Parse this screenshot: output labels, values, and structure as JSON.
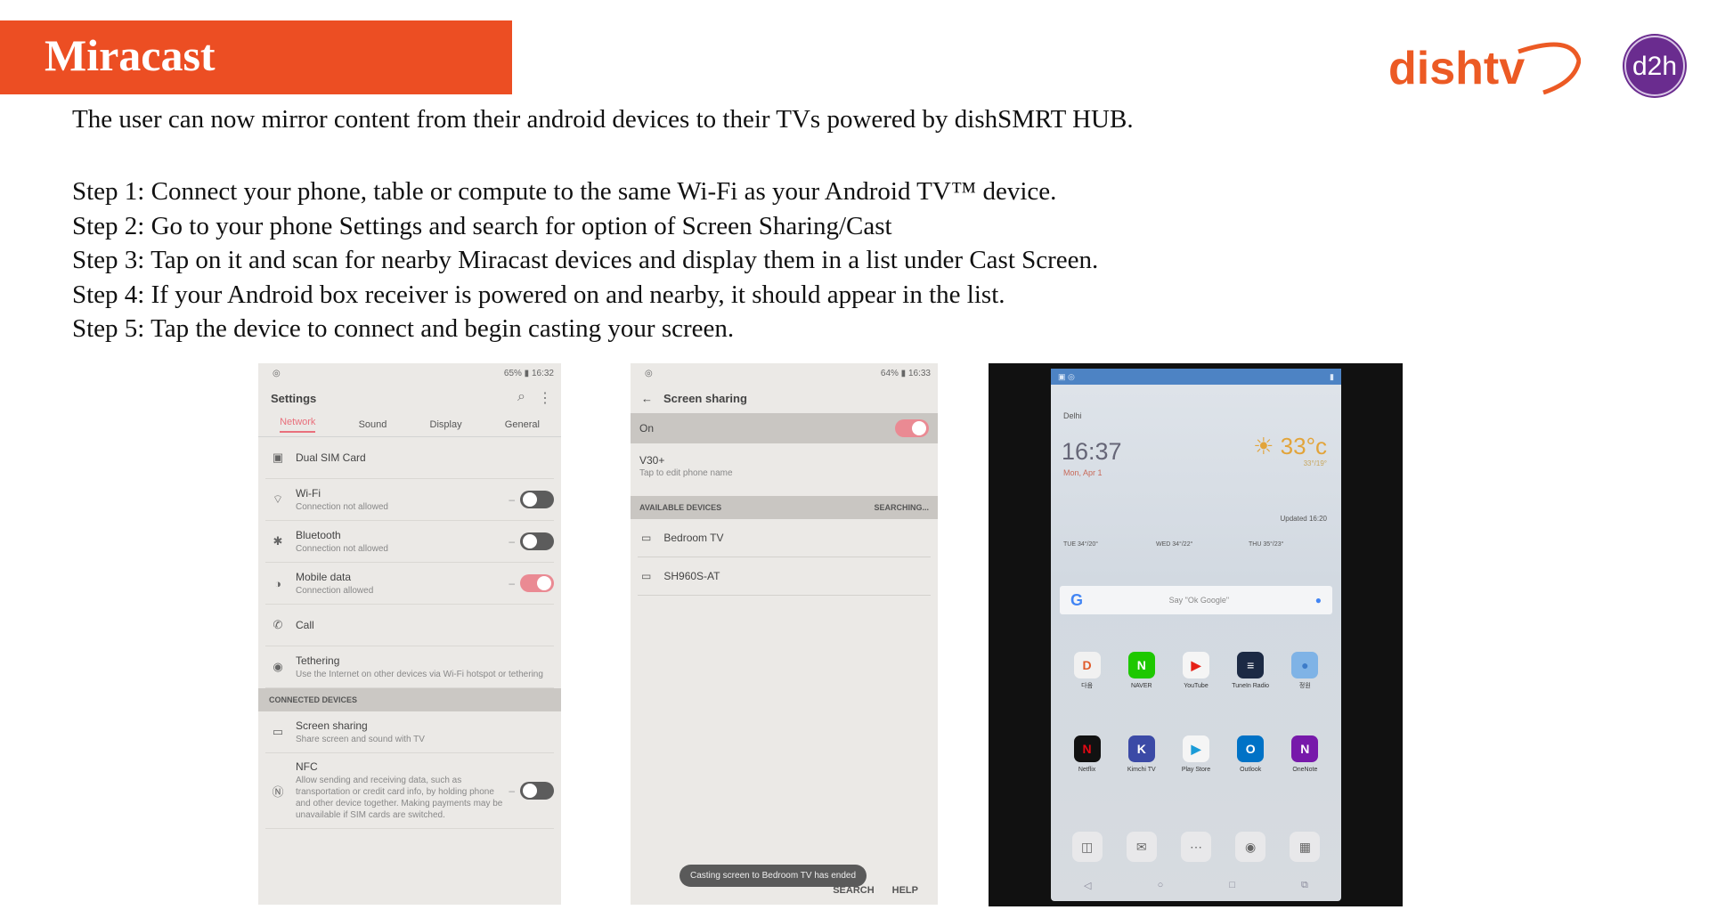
{
  "header": {
    "title": "Miracast",
    "brand_logo_dishtv": "dishtv",
    "brand_logo_d2h": "d2h"
  },
  "intro": "The user can now mirror content from their android devices to their TVs powered by dishSMRT HUB.",
  "steps": [
    "Step 1: Connect your phone, table or compute to the same Wi-Fi as your Android TV™ device.",
    "Step 2: Go to your phone Settings and search for option of Screen Sharing/Cast",
    "Step 3: Tap on it and scan for nearby Miracast devices and display them in a list under Cast Screen.",
    "Step 4: If your Android box receiver is powered on and nearby, it should appear in the list.",
    "Step 5: Tap the device to connect and begin casting your screen."
  ],
  "screenshot1": {
    "status_time": "65% ▮ 16:32",
    "title": "Settings",
    "tabs": [
      "Network",
      "Sound",
      "Display",
      "General"
    ],
    "rows": [
      {
        "label": "Dual SIM Card",
        "sub": "",
        "toggle": "none",
        "icon": "sim-icon"
      },
      {
        "label": "Wi-Fi",
        "sub": "Connection not allowed",
        "toggle": "off",
        "icon": "wifi-icon"
      },
      {
        "label": "Bluetooth",
        "sub": "Connection not allowed",
        "toggle": "off",
        "icon": "bluetooth-icon"
      },
      {
        "label": "Mobile data",
        "sub": "Connection allowed",
        "toggle": "on",
        "icon": "mobile-data-icon"
      },
      {
        "label": "Call",
        "sub": "",
        "toggle": "none",
        "icon": "phone-icon"
      },
      {
        "label": "Tethering",
        "sub": "Use the Internet on other devices via Wi-Fi hotspot or tethering",
        "toggle": "none",
        "icon": "tethering-icon"
      }
    ],
    "section": "CONNECTED DEVICES",
    "rows2": [
      {
        "label": "Screen sharing",
        "sub": "Share screen and sound with TV",
        "icon": "cast-icon"
      },
      {
        "label": "NFC",
        "sub": "Allow sending and receiving data, such as transportation or credit card info, by holding phone and other device together. Making payments may be unavailable if SIM cards are switched.",
        "icon": "nfc-icon"
      }
    ]
  },
  "screenshot2": {
    "status_time": "64% ▮ 16:33",
    "title": "Screen sharing",
    "on_label": "On",
    "device_name": "V30+",
    "device_sub": "Tap to edit phone name",
    "available": "AVAILABLE DEVICES",
    "searching": "SEARCHING...",
    "devices": [
      "Bedroom TV",
      "SH960S-AT"
    ],
    "toast": "Casting screen to Bedroom TV has ended",
    "actions": [
      "SEARCH",
      "HELP"
    ]
  },
  "screenshot3": {
    "city": "Delhi",
    "time": "16:37",
    "date": "Mon, Apr 1",
    "temp": "33°c",
    "temp_range": "33°/19°",
    "updated": "Updated 16:20",
    "forecast": [
      "TUE 34°/20°",
      "WED 34°/22°",
      "THU 35°/23°"
    ],
    "search_hint": "Say \"Ok Google\"",
    "apps_row1": [
      {
        "label": "다음",
        "glyph": "D",
        "color": "#f1f1f1",
        "fg": "#e05a2a"
      },
      {
        "label": "NAVER",
        "glyph": "N",
        "color": "#1ec800",
        "fg": "#ffffff"
      },
      {
        "label": "YouTube",
        "glyph": "▶",
        "color": "#f5f5f5",
        "fg": "#e62117"
      },
      {
        "label": "TuneIn Radio",
        "glyph": "≡",
        "color": "#1c2a44",
        "fg": "#ffffff"
      },
      {
        "label": "정원",
        "glyph": "●",
        "color": "#7fb3e6",
        "fg": "#3d7cc9"
      }
    ],
    "apps_row2": [
      {
        "label": "Netflix",
        "glyph": "N",
        "color": "#111111",
        "fg": "#e50914"
      },
      {
        "label": "Kimchi TV",
        "glyph": "K",
        "color": "#3b4aa6",
        "fg": "#ffffff"
      },
      {
        "label": "Play Store",
        "glyph": "▶",
        "color": "#f5f5f5",
        "fg": "#1a9bd7"
      },
      {
        "label": "Outlook",
        "glyph": "O",
        "color": "#0072c6",
        "fg": "#ffffff"
      },
      {
        "label": "OneNote",
        "glyph": "N",
        "color": "#7719aa",
        "fg": "#ffffff"
      }
    ]
  },
  "colors": {
    "title_bar": "#ec4e23",
    "dishtv_orange": "#ec5a24",
    "d2h_purple": "#6a2c8f"
  }
}
